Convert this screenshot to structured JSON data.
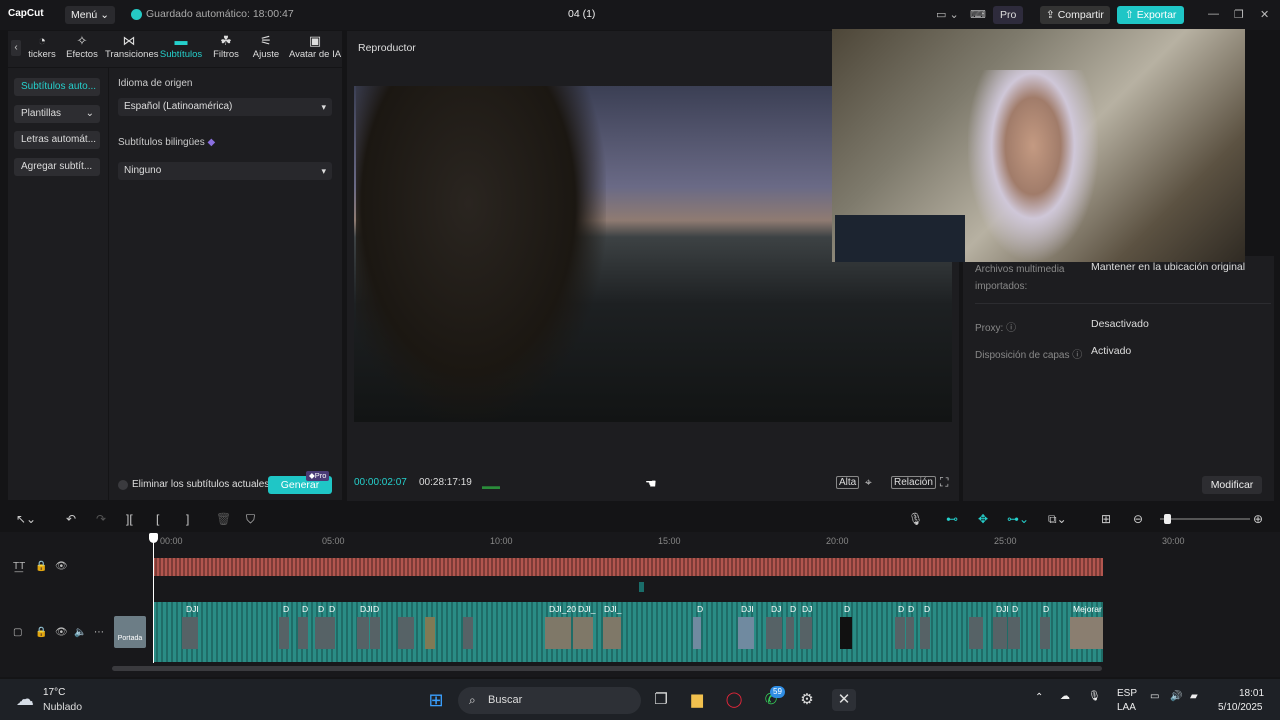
{
  "titlebar": {
    "logo": "CapCut",
    "menu": "Menú",
    "autosave": "Guardado automático: 18:00:47",
    "project": "04 (1)",
    "pro": "Pro",
    "share": "Compartir",
    "export": "Exportar"
  },
  "tabs": [
    {
      "label": "tickers",
      "icon": "sticker-icon"
    },
    {
      "label": "Efectos",
      "icon": "effects-icon"
    },
    {
      "label": "Transiciones",
      "icon": "transitions-icon"
    },
    {
      "label": "Subtítulos",
      "icon": "subtitles-icon"
    },
    {
      "label": "Filtros",
      "icon": "filters-icon"
    },
    {
      "label": "Ajuste",
      "icon": "adjust-icon"
    },
    {
      "label": "Avatar de IA",
      "icon": "avatar-icon"
    }
  ],
  "leftnav": [
    "Subtítulos auto...",
    "Plantillas",
    "Letras automát...",
    "Agregar subtít..."
  ],
  "settings": {
    "source_lang_label": "Idioma de origen",
    "source_lang_value": "Español (Latinoamérica)",
    "bilingual_label": "Subtítulos bilingües",
    "bilingual_value": "Ninguno",
    "remove_label": "Eliminar los subtítulos actuales",
    "generate": "Generar",
    "pro_tag": "Pro"
  },
  "player": {
    "title": "Reproductor",
    "current_time": "00:00:02:07",
    "total_time": "00:28:17:19",
    "quality": "Alta",
    "ratio": "Relación"
  },
  "rightpanel": {
    "rows": [
      {
        "key": "Archivos multimedia importados:",
        "value": "Mantener en la ubicación original"
      },
      {
        "key": "Proxy:",
        "value": "Desactivado"
      },
      {
        "key": "Disposición de capas",
        "value": "Activado"
      }
    ],
    "modify": "Modificar"
  },
  "timeline": {
    "ticks": [
      "00:00",
      "05:00",
      "10:00",
      "15:00",
      "20:00",
      "25:00",
      "30:00"
    ],
    "cover": "Portada",
    "clip_labels": [
      "DJI",
      "D",
      "D",
      "D",
      "D",
      "DJI",
      "D",
      "DJI_20",
      "DJI_",
      "DJI_",
      "D",
      "DJI",
      "DJ",
      "D",
      "DJ",
      "D",
      "D",
      "D",
      "D",
      "DJI",
      "D",
      "D",
      "Mejorar"
    ]
  },
  "taskbar": {
    "temp": "17°C",
    "weather": "Nublado",
    "search": "Buscar",
    "whatsapp_badge": "59",
    "lang1": "ESP",
    "lang2": "LAA",
    "time": "18:01",
    "date": "5/10/2025"
  }
}
